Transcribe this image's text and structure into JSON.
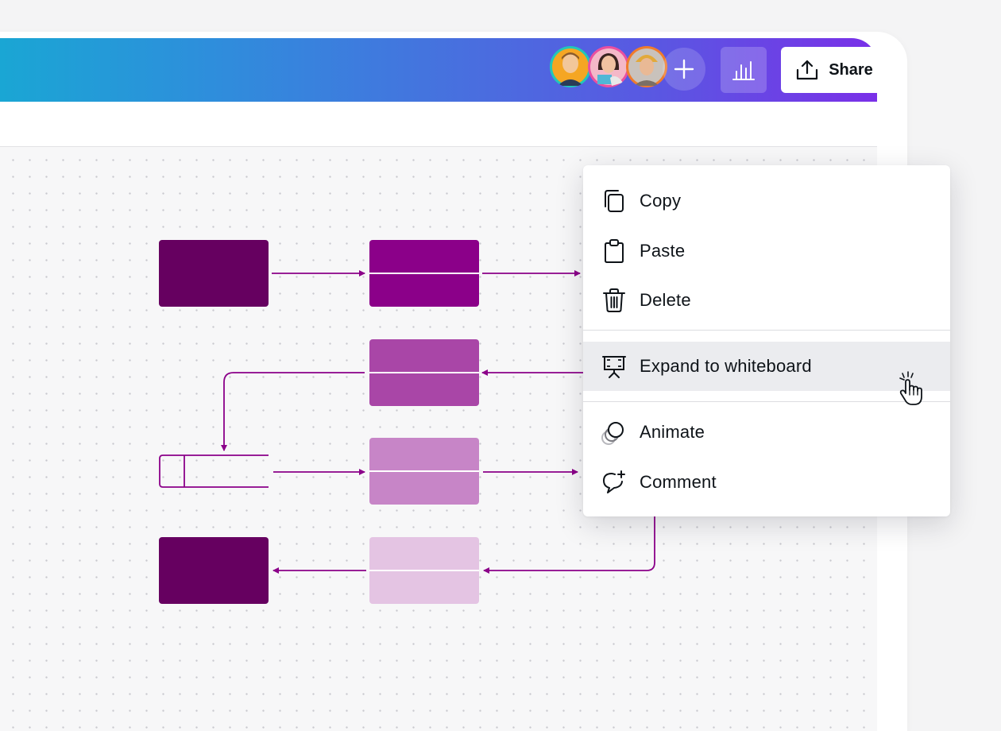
{
  "header": {
    "collaborators": [
      {
        "name": "collaborator-1",
        "ring": "#22c7b8"
      },
      {
        "name": "collaborator-2",
        "ring": "#ea4fa0"
      },
      {
        "name": "collaborator-3",
        "ring": "#f07c2c"
      }
    ],
    "add_icon": "plus-icon",
    "insights_icon": "bar-chart-icon",
    "share_label": "Share",
    "share_icon": "upload-icon"
  },
  "context_menu": {
    "items": [
      {
        "label": "Copy",
        "icon": "copy-icon"
      },
      {
        "label": "Paste",
        "icon": "clipboard-icon"
      },
      {
        "label": "Delete",
        "icon": "trash-icon"
      },
      {
        "label": "Expand to whiteboard",
        "icon": "whiteboard-icon",
        "highlighted": true
      },
      {
        "label": "Animate",
        "icon": "animate-icon"
      },
      {
        "label": "Comment",
        "icon": "comment-add-icon"
      }
    ]
  },
  "colors": {
    "gradient_start": "#1aa6d4",
    "gradient_end": "#7a30e8",
    "shape_dark": "#660060",
    "shape_purple": "#8b0089",
    "shape_mid": "#a946a7",
    "shape_light": "#c785c7",
    "shape_pale": "#e4c4e3",
    "connector": "#8b0089"
  }
}
